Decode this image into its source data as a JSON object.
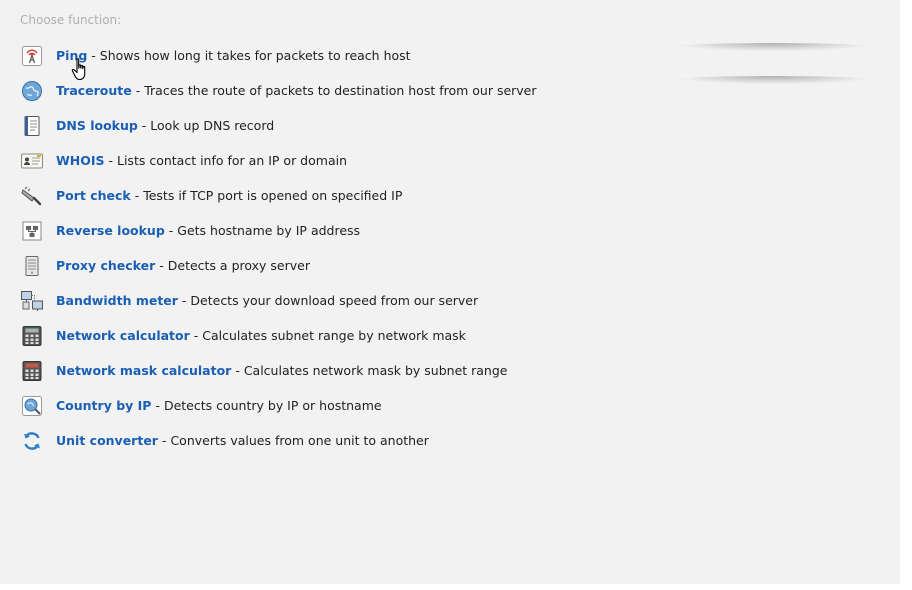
{
  "heading": "Choose function:",
  "separator": " - ",
  "functions": [
    {
      "name": "Ping",
      "description": "Shows how long it takes for packets to reach host",
      "icon": "ping-icon"
    },
    {
      "name": "Traceroute",
      "description": "Traces the route of packets to destination host from our server",
      "icon": "globe-icon"
    },
    {
      "name": "DNS lookup",
      "description": "Look up DNS record",
      "icon": "book-icon"
    },
    {
      "name": "WHOIS",
      "description": "Lists contact info for an IP or domain",
      "icon": "id-card-icon"
    },
    {
      "name": "Port check",
      "description": "Tests if TCP port is opened on specified IP",
      "icon": "plug-icon"
    },
    {
      "name": "Reverse lookup",
      "description": "Gets hostname by IP address",
      "icon": "network-icon"
    },
    {
      "name": "Proxy checker",
      "description": "Detects a proxy server",
      "icon": "server-icon"
    },
    {
      "name": "Bandwidth meter",
      "description": "Detects your download speed from our server",
      "icon": "computers-icon"
    },
    {
      "name": "Network calculator",
      "description": "Calculates subnet range by network mask",
      "icon": "calculator-icon"
    },
    {
      "name": "Network mask calculator",
      "description": "Calculates network mask by subnet range",
      "icon": "calculator-red-icon"
    },
    {
      "name": "Country by IP",
      "description": "Detects country by IP or hostname",
      "icon": "globe-search-icon"
    },
    {
      "name": "Unit converter",
      "description": "Converts values from one unit to another",
      "icon": "refresh-icon"
    }
  ],
  "colors": {
    "link": "#1a5fb4",
    "background": "#f2f2f2",
    "heading": "#b0b0b0"
  }
}
